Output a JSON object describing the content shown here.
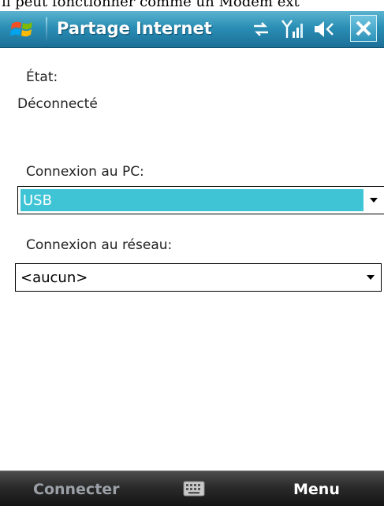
{
  "page_top_text": "il peut fonctionner comme un Modem ext",
  "titlebar": {
    "title": "Partage Internet",
    "icons": [
      "start-flag-icon",
      "connectivity-icon",
      "signal-icon",
      "volume-icon",
      "close-icon"
    ]
  },
  "status": {
    "label": "État:",
    "value": "Déconnecté"
  },
  "pc_connection": {
    "label": "Connexion au PC:",
    "selected": "USB"
  },
  "network_connection": {
    "label": "Connexion au réseau:",
    "selected": "<aucun>"
  },
  "softkeys": {
    "left": "Connecter",
    "right": "Menu",
    "middle_icon": "keyboard-icon"
  },
  "colors": {
    "titlebar": "#2a8fb5",
    "selection": "#3fc4d6",
    "bottombar": "#2b2b2b",
    "softkey_left": "#9aa0a6",
    "softkey_right": "#ffffff"
  }
}
